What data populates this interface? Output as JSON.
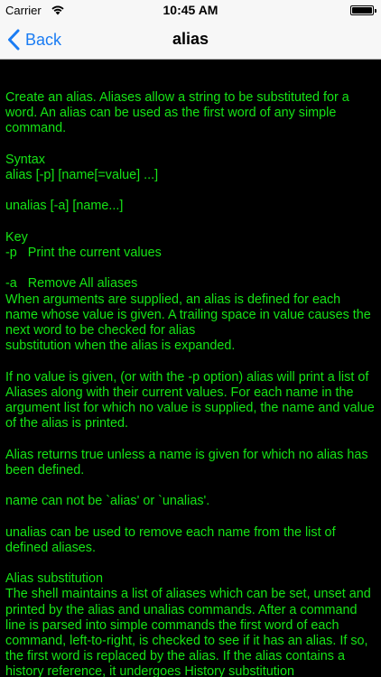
{
  "status": {
    "carrier": "Carrier",
    "time": "10:45 AM"
  },
  "nav": {
    "back_label": "Back",
    "title": "alias"
  },
  "colors": {
    "text": "#16e316",
    "background": "#000000",
    "accent": "#1a7cf3"
  },
  "content": {
    "intro": "Create an alias. Aliases allow a string to be substituted for a word. An alias can be used as the first word of any simple command.",
    "syntax_heading": "Syntax",
    "syntax_alias": "alias [-p] [name[=value] ...]",
    "syntax_unalias": "unalias [-a] [name...]",
    "key_heading": "Key",
    "key_p": "-p   Print the current values",
    "key_a": "-a   Remove All aliases",
    "desc1": "When arguments are supplied, an alias is defined for each name whose value is given. A trailing space in value causes the next word to be checked for alias\nsubstitution when the alias is expanded.",
    "desc2": "If no value is given, (or with the -p option) alias will print a list of Aliases along with their current values. For each name in the argument list for which no value is supplied, the name and value of the alias is printed.",
    "desc3": "Alias returns true unless a name is given for which no alias has been defined.",
    "desc4": "name can not be `alias' or `unalias'.",
    "desc5": "unalias can be used to remove each name from the list of defined aliases.",
    "subst_heading": "Alias substitution",
    "subst_text": "The shell maintains a list of aliases which can be set, unset and printed by the alias and unalias commands. After a command line is parsed into simple commands the first word of each command, left-to-right, is checked to see if it has an alias. If so, the first word is replaced by the alias. If the alias contains a history reference, it undergoes History substitution"
  }
}
